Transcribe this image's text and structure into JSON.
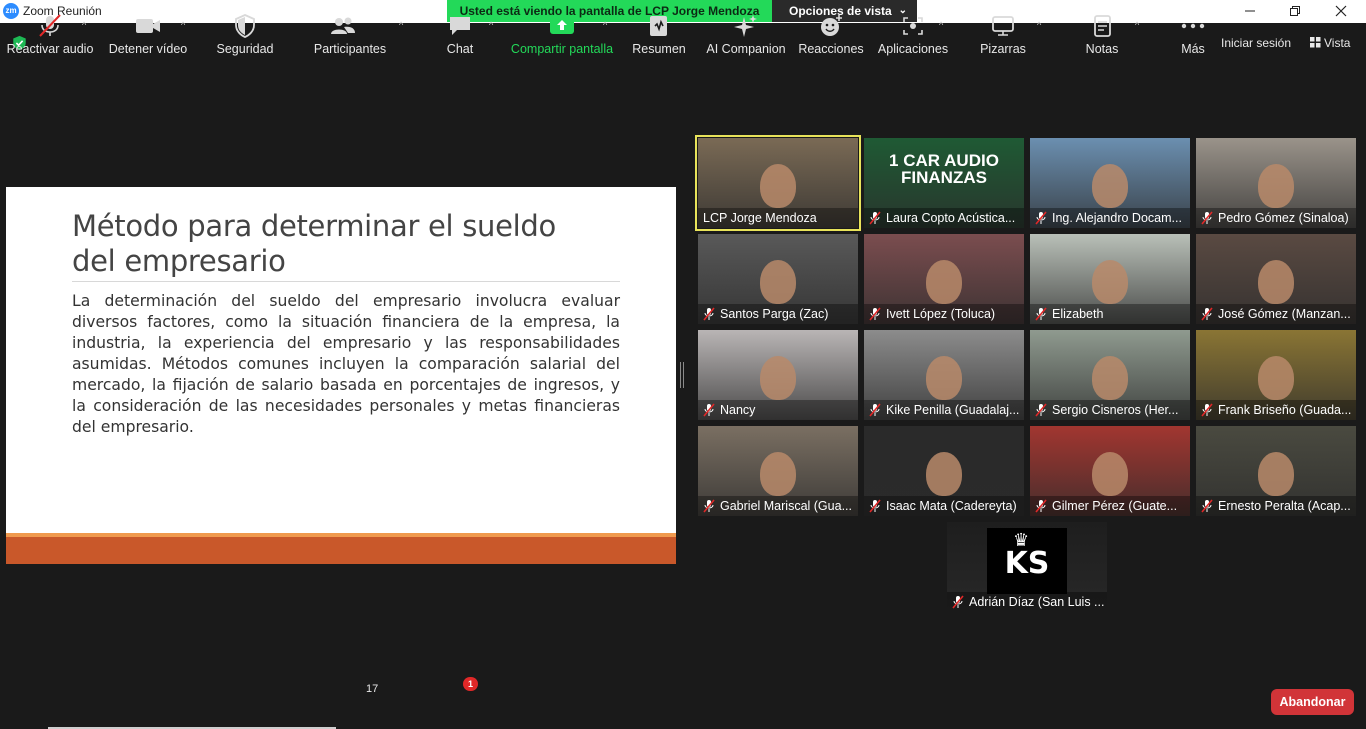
{
  "window": {
    "app_logo": "zm",
    "title": "Zoom Reunión",
    "controls": [
      "minimize-icon",
      "restore-icon",
      "close-icon"
    ]
  },
  "banner": {
    "viewing": "Usted está viendo la pantalla de LCP Jorge Mendoza",
    "view_options": "Opciones de vista"
  },
  "top_right": {
    "sign_in": "Iniciar sesión",
    "view": "Vista"
  },
  "slide": {
    "title": "Método para determinar el sueldo del empresario",
    "body": "La determinación del sueldo del empresario involucra evaluar diversos factores, como la situación financiera de la empresa, la industria, la experiencia del empresario y las responsabilidades asumidas. Métodos comunes incluyen la comparación salarial del mercado, la fijación de salario basada en porcentajes de ingresos, y la consideración de las necesidades personales y metas financieras del empresario."
  },
  "tile_overlay": {
    "line1": "1 CAR AUDIO",
    "line2": "FINANZAS"
  },
  "avatar_logo": "KS",
  "participants": [
    {
      "name": "LCP Jorge Mendoza",
      "muted": false,
      "active": true,
      "color": "#7a6a55"
    },
    {
      "name": "Laura Copto Acústica...",
      "muted": true,
      "active": false,
      "color": "#1f5a34"
    },
    {
      "name": "Ing. Alejandro Docam...",
      "muted": true,
      "active": false,
      "color": "#6b8fb0"
    },
    {
      "name": "Pedro Gómez (Sinaloa)",
      "muted": true,
      "active": false,
      "color": "#9a938a"
    },
    {
      "name": "Santos Parga (Zac)",
      "muted": true,
      "active": false,
      "color": "#595959"
    },
    {
      "name": "Ivett López (Toluca)",
      "muted": true,
      "active": false,
      "color": "#7b4d4f"
    },
    {
      "name": "Elizabeth",
      "muted": true,
      "active": false,
      "color": "#b9c0b8"
    },
    {
      "name": "José Gómez (Manzan...",
      "muted": true,
      "active": false,
      "color": "#5a4a42"
    },
    {
      "name": "Nancy",
      "muted": true,
      "active": false,
      "color": "#b9b5b5"
    },
    {
      "name": "Kike Penilla (Guadalaj...",
      "muted": true,
      "active": false,
      "color": "#8c8c8c"
    },
    {
      "name": "Sergio Cisneros (Her...",
      "muted": true,
      "active": false,
      "color": "#8f9a8f"
    },
    {
      "name": "Frank Briseño (Guada...",
      "muted": true,
      "active": false,
      "color": "#8a7534"
    },
    {
      "name": "Gabriel Mariscal (Gua...",
      "muted": true,
      "active": false,
      "color": "#7a6f62"
    },
    {
      "name": "Isaac Mata (Cadereyta)",
      "muted": true,
      "active": false,
      "color": "#2a2a2a"
    },
    {
      "name": "Gilmer Pérez (Guate...",
      "muted": true,
      "active": false,
      "color": "#a23630"
    },
    {
      "name": "Ernesto Peralta (Acap...",
      "muted": true,
      "active": false,
      "color": "#4a4a40"
    },
    {
      "name": "Adrián Díaz (San Luis ...",
      "muted": true,
      "active": false,
      "color": "#1e1e1e"
    }
  ],
  "toolbar": {
    "items": [
      {
        "label": "Reactivar audio",
        "icon": "mic-muted-icon"
      },
      {
        "label": "Detener vídeo",
        "icon": "video-camera-icon"
      },
      {
        "label": "Seguridad",
        "icon": "shield-icon"
      },
      {
        "label": "Participantes",
        "icon": "participants-icon"
      },
      {
        "label": "Chat",
        "icon": "chat-icon"
      },
      {
        "label": "Compartir pantalla",
        "icon": "share-screen-icon"
      },
      {
        "label": "Resumen",
        "icon": "summary-icon"
      },
      {
        "label": "AI Companion",
        "icon": "sparkle-icon"
      },
      {
        "label": "Reacciones",
        "icon": "reaction-icon"
      },
      {
        "label": "Aplicaciones",
        "icon": "apps-icon"
      },
      {
        "label": "Pizarras",
        "icon": "whiteboard-icon"
      },
      {
        "label": "Notas",
        "icon": "notes-icon"
      },
      {
        "label": "Más",
        "icon": "more-icon"
      }
    ],
    "participant_count": "17",
    "chat_badge": "1",
    "leave": "Abandonar"
  },
  "colors": {
    "share_green": "#23d959",
    "leave_red": "#d13438",
    "slide_accent": "#c9582a",
    "active_speaker": "#e8e35a"
  }
}
